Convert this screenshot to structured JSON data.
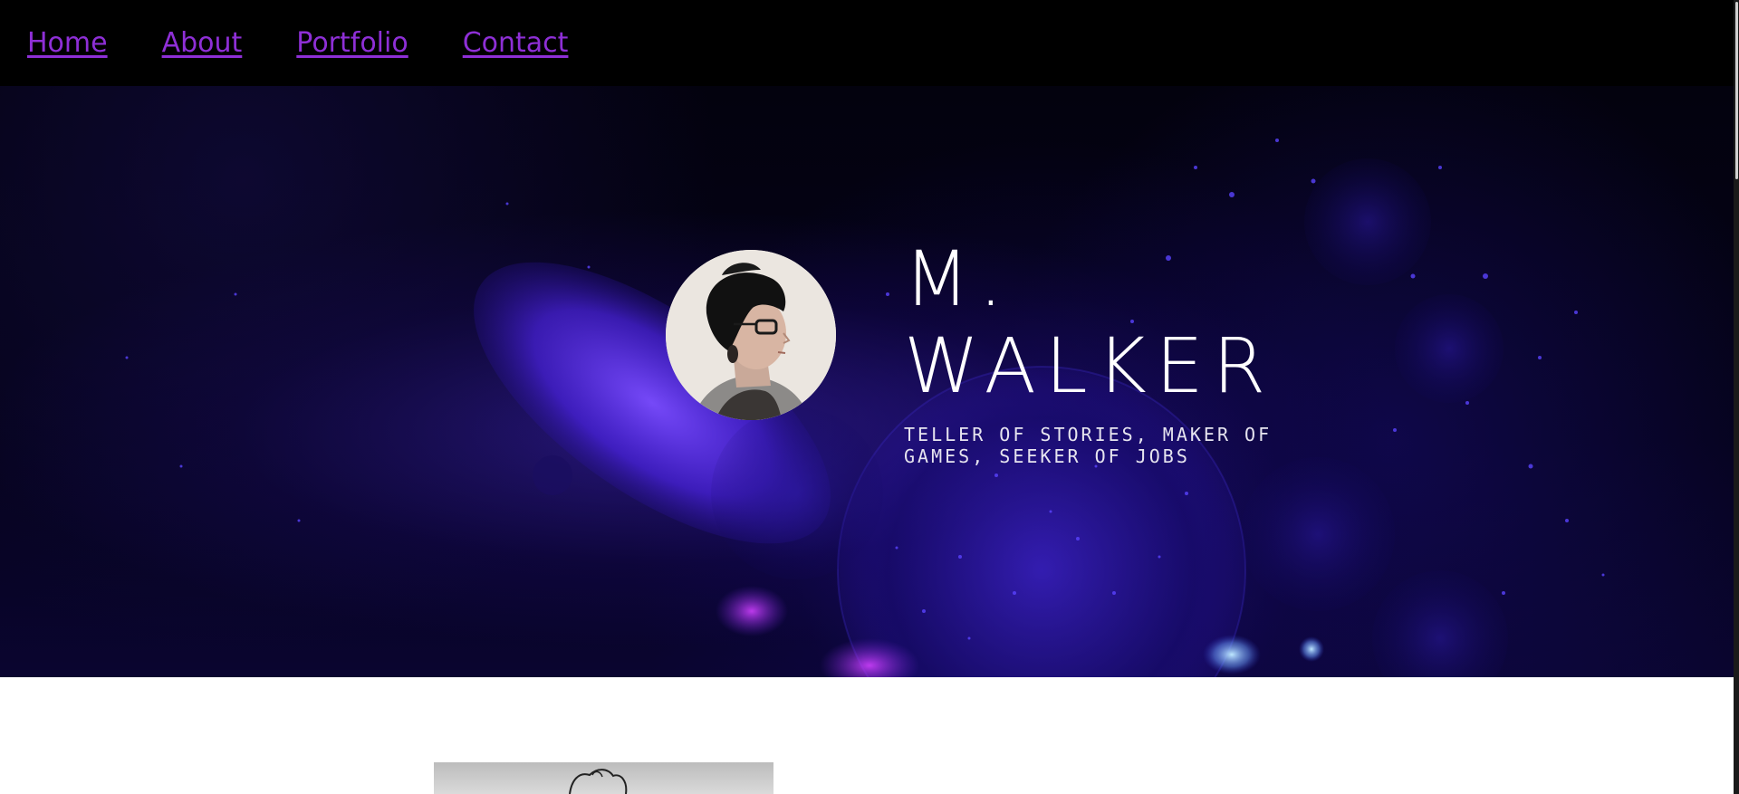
{
  "nav": {
    "items": [
      {
        "label": "Home"
      },
      {
        "label": "About"
      },
      {
        "label": "Portfolio"
      },
      {
        "label": "Contact"
      }
    ]
  },
  "hero": {
    "name_line1": "M.",
    "name_line2": "WALKER",
    "tagline": "Teller of Stories, Maker of Games, Seeker of Jobs"
  },
  "colors": {
    "nav_bg": "#000000",
    "nav_link": "#8e2fd6",
    "hero_text": "#ffffff"
  }
}
